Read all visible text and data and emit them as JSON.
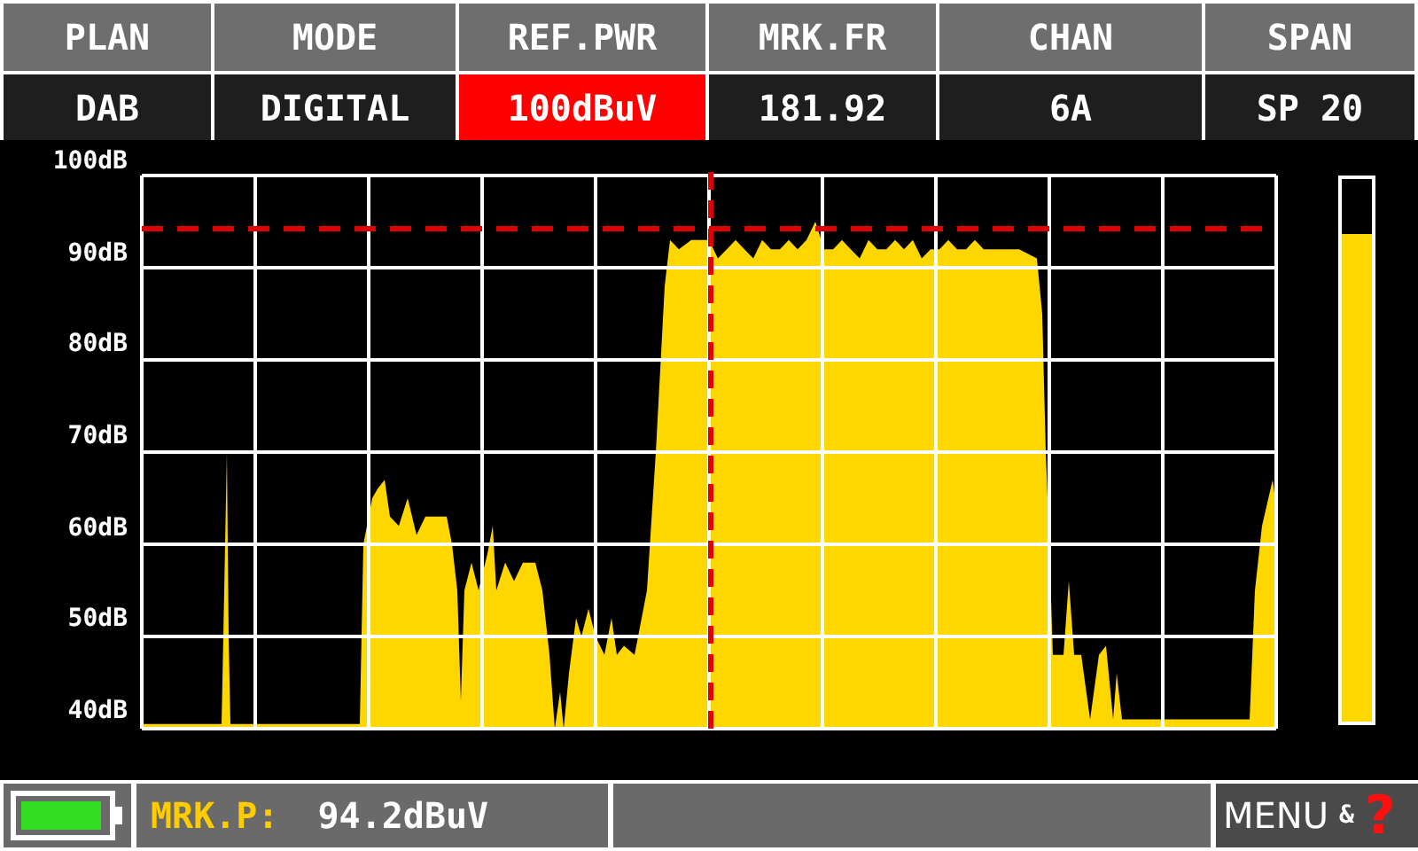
{
  "header": [
    {
      "label": "PLAN",
      "value": "DAB",
      "selected": false
    },
    {
      "label": "MODE",
      "value": "DIGITAL",
      "selected": false
    },
    {
      "label": "REF.PWR",
      "value": "100dBuV",
      "selected": true
    },
    {
      "label": "MRK.FR",
      "value": "181.92",
      "selected": false
    },
    {
      "label": "CHAN",
      "value": "6A",
      "selected": false
    },
    {
      "label": "SPAN",
      "value": "SP 20",
      "selected": false
    }
  ],
  "spectrum": {
    "y_labels": [
      "100dB",
      "90dB",
      "80dB",
      "70dB",
      "60dB",
      "50dB",
      "40dB"
    ]
  },
  "level_meter": {
    "level": 0.9
  },
  "status_bar": {
    "marker_label": "MRK.P:",
    "marker_value": "94.2dBuV",
    "menu": "MENU",
    "amp": "&",
    "help": "?"
  }
}
